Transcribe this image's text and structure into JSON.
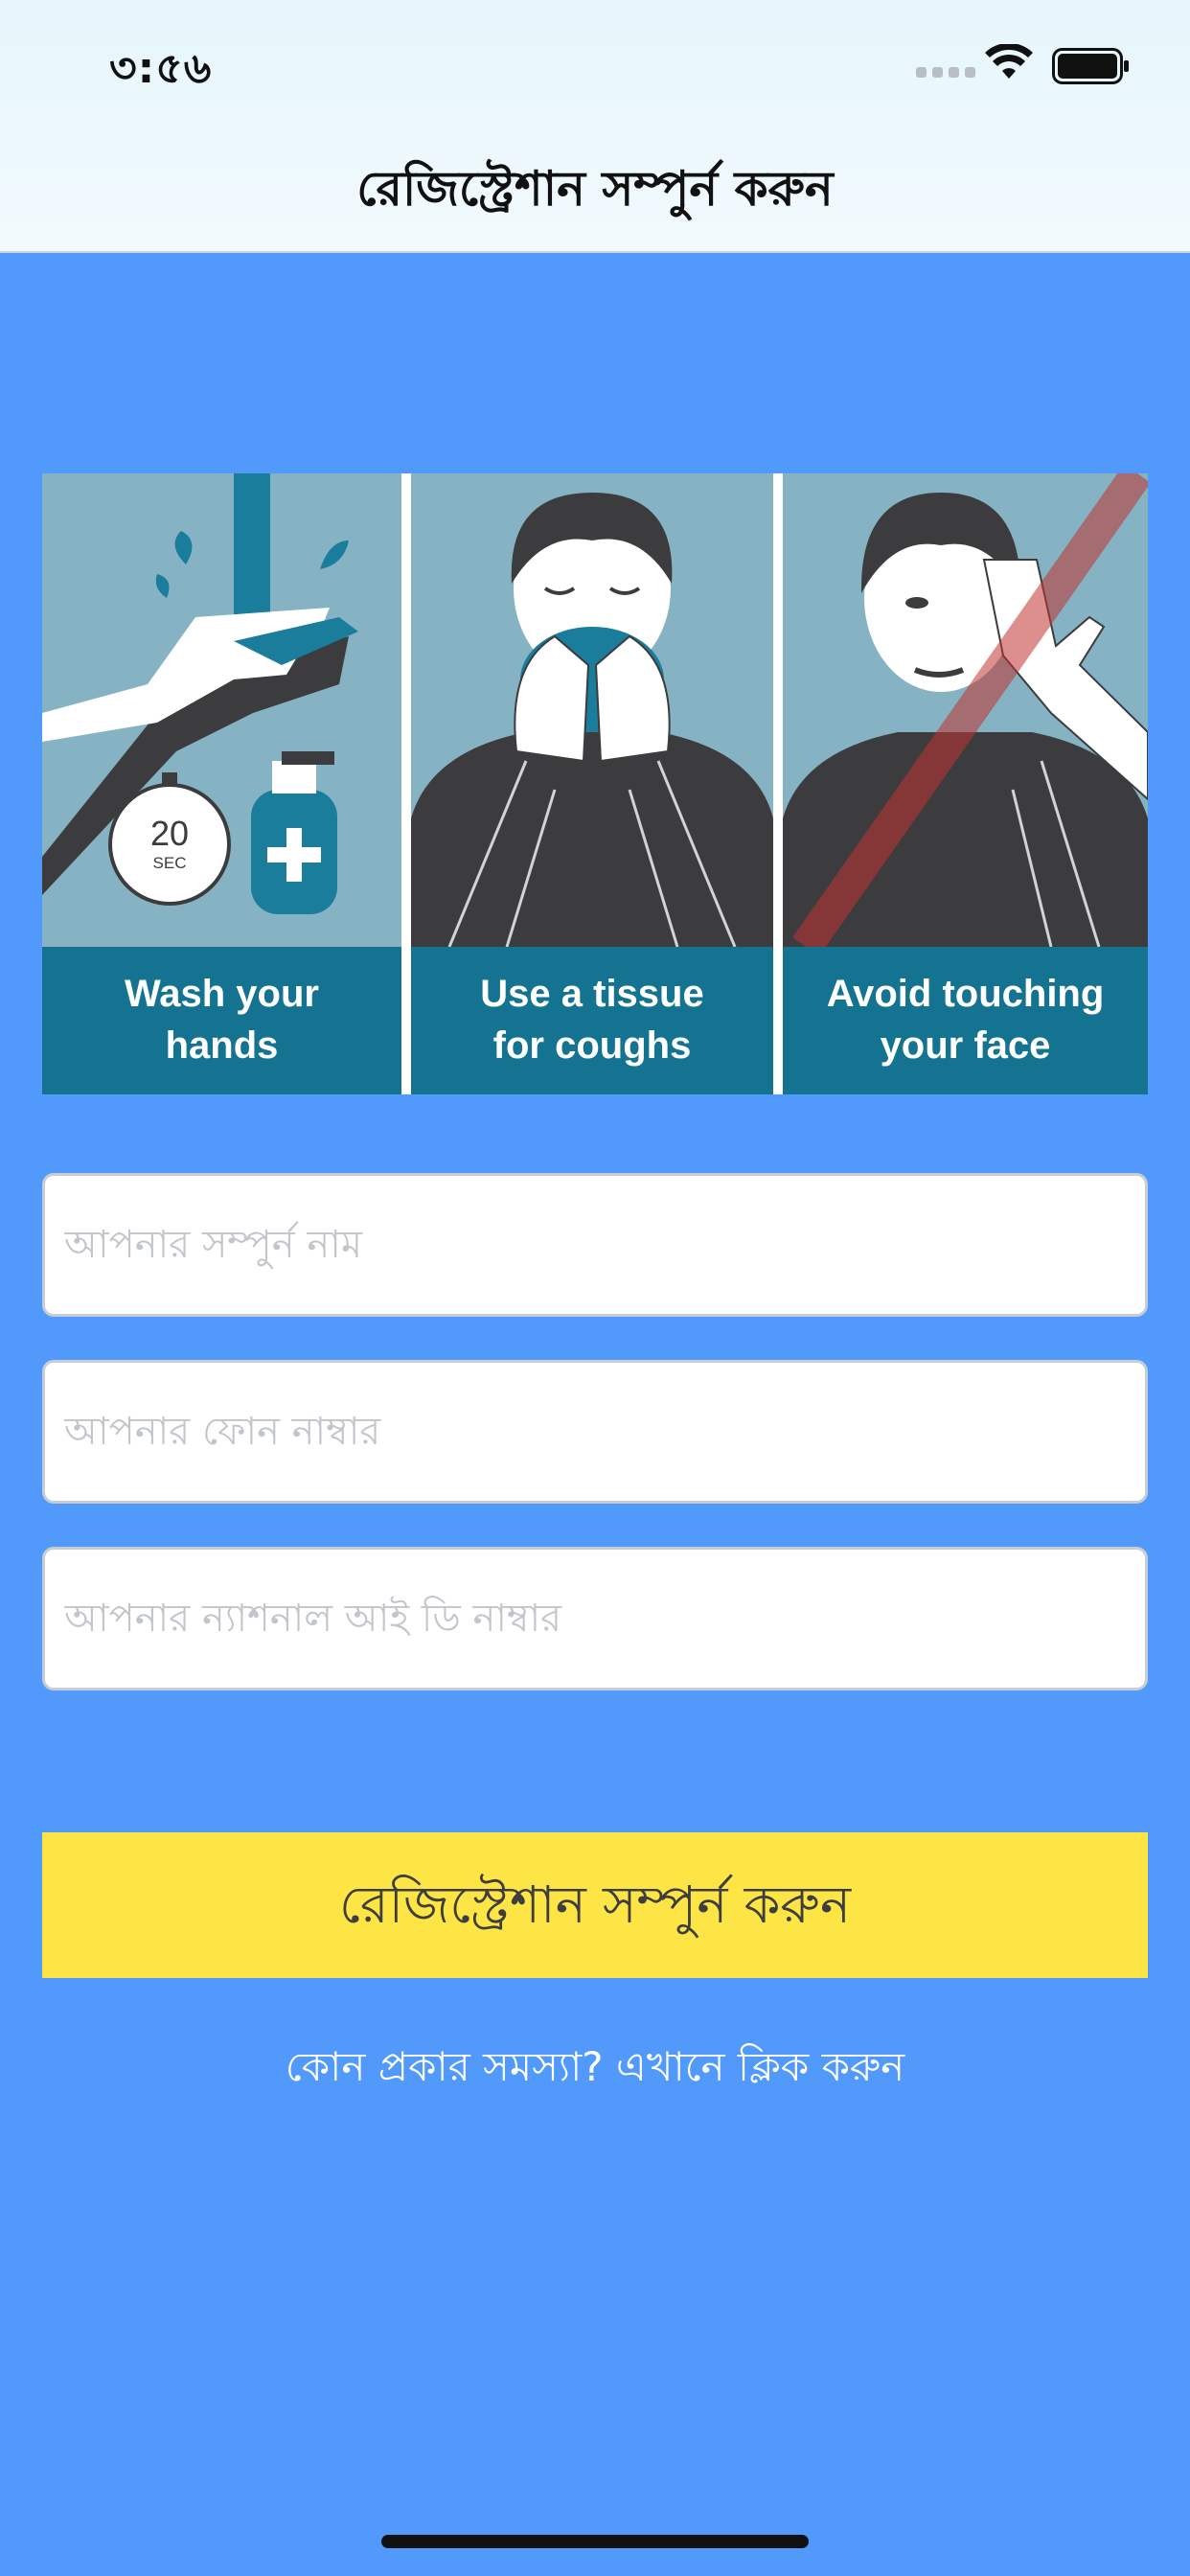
{
  "status_bar": {
    "time": "৩:৫৬"
  },
  "header": {
    "title": "রেজিস্ট্রেশান সম্পুর্ন করুন"
  },
  "banner": {
    "panels": [
      {
        "icon": "hand-washing-icon",
        "line1": "Wash your",
        "line2": "hands",
        "timer_value": "20",
        "timer_unit": "SEC"
      },
      {
        "icon": "tissue-cough-icon",
        "line1": "Use a tissue",
        "line2": "for coughs"
      },
      {
        "icon": "no-face-touch-icon",
        "line1": "Avoid touching",
        "line2": "your face"
      }
    ]
  },
  "form": {
    "full_name_placeholder": "আপনার সম্পুর্ন নাম",
    "phone_placeholder": "আপনার ফোন নাম্বার",
    "national_id_placeholder": "আপনার ন্যাশনাল আই ডি নাম্বার",
    "submit_label": "রেজিস্ট্রেশান সম্পুর্ন করুন",
    "help_link": "কোন প্রকার সমস্যা? এখানে ক্লিক করুন"
  },
  "colors": {
    "background": "#5199fb",
    "button": "#fde546",
    "banner_caption": "#137390",
    "banner_art": "#86b3c3"
  }
}
